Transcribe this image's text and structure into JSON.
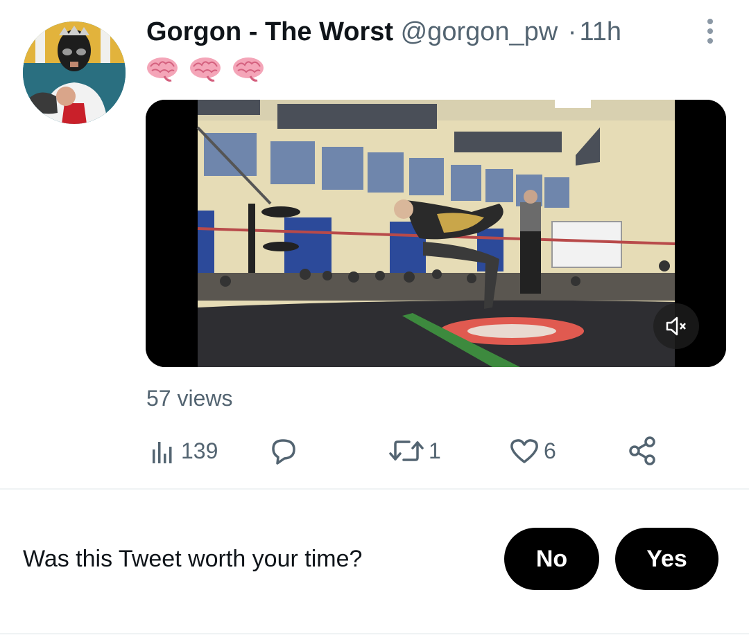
{
  "tweet": {
    "author_name": "Gorgon - The Worst",
    "handle": "@gorgon_pw",
    "separator": "·",
    "timestamp": "11h",
    "emoji": [
      "brain",
      "brain",
      "brain"
    ],
    "views_label": "57 views"
  },
  "actions": {
    "analytics_count": "139",
    "reply_count": "",
    "retweet_count": "1",
    "like_count": "6"
  },
  "icons": {
    "more": "more-vertical-icon",
    "mute": "mute-icon",
    "analytics": "analytics-icon",
    "reply": "reply-icon",
    "retweet": "retweet-icon",
    "like": "heart-icon",
    "share": "share-icon"
  },
  "feedback": {
    "question": "Was this Tweet worth your time?",
    "no_label": "No",
    "yes_label": "Yes"
  },
  "colors": {
    "text_primary": "#0f1419",
    "text_secondary": "#536471",
    "button_bg": "#000000",
    "divider": "#eff3f4"
  }
}
